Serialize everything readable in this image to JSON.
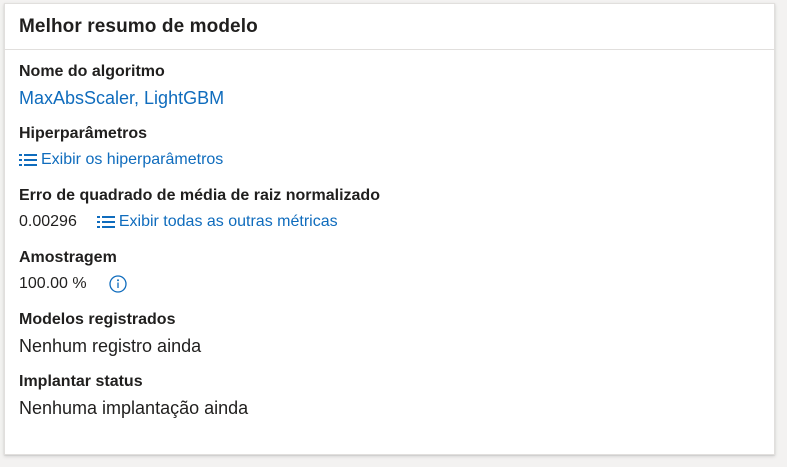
{
  "card": {
    "title": "Melhor resumo de modelo"
  },
  "algorithm": {
    "label": "Nome do algoritmo",
    "value": "MaxAbsScaler, LightGBM"
  },
  "hyperparameters": {
    "label": "Hiperparâmetros",
    "link": "Exibir os hiperparâmetros",
    "icon": "list-icon"
  },
  "metric": {
    "label": "Erro de quadrado de média de raiz normalizado",
    "value": "0.00296",
    "link": "Exibir todas as outras métricas",
    "icon": "list-icon"
  },
  "sampling": {
    "label": "Amostragem",
    "value": "100.00 %",
    "icon": "info-icon"
  },
  "registered_models": {
    "label": "Modelos registrados",
    "value": "Nenhum registro ainda"
  },
  "deploy_status": {
    "label": "Implantar status",
    "value": "Nenhuma implantação ainda"
  },
  "colors": {
    "link": "#0f6cbd",
    "text": "#201f1e",
    "border": "#e1dfdd",
    "background": "#f3f2f1"
  }
}
